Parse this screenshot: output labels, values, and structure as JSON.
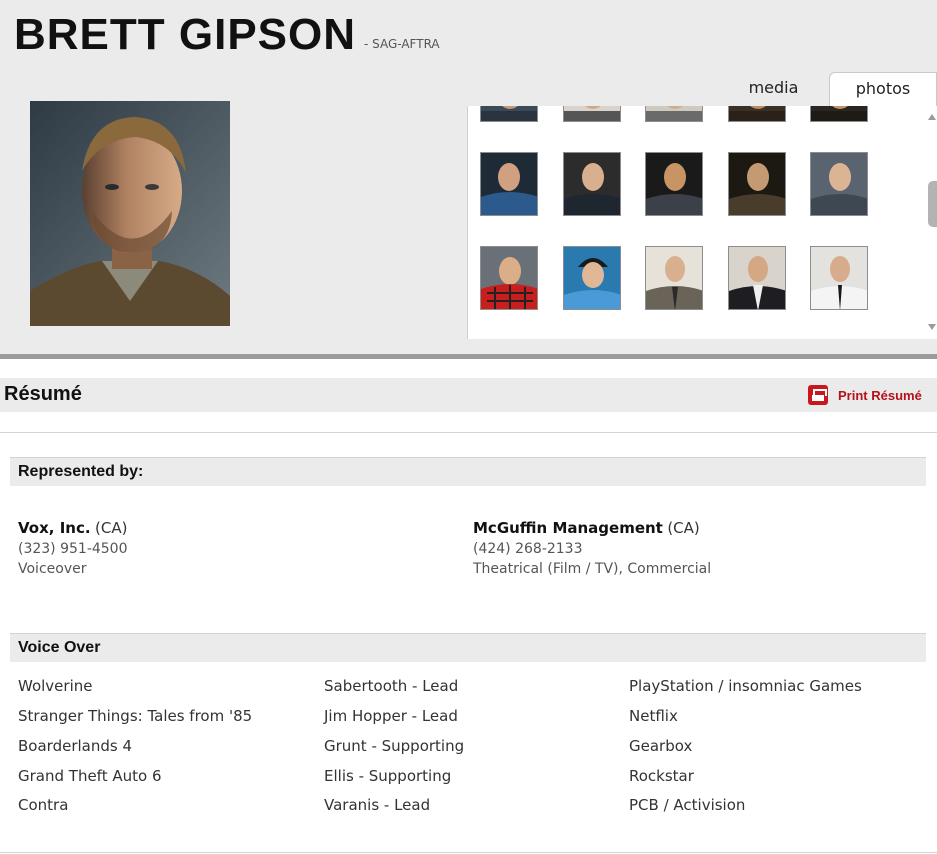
{
  "header": {
    "name": "BRETT GIPSON",
    "union": "- SAG-AFTRA"
  },
  "tabs": [
    {
      "label": "media"
    },
    {
      "label": "photos"
    }
  ],
  "resume": {
    "title": "Résumé",
    "print_label": "Print Résumé"
  },
  "represented": {
    "title": "Represented by:",
    "agencies": [
      {
        "name": "Vox, Inc.",
        "location": "(CA)",
        "phone": "(323) 951-4500",
        "type": "Voiceover"
      },
      {
        "name": "McGuffin Management",
        "location": "(CA)",
        "phone": "(424) 268-2133",
        "type": "Theatrical (Film / TV), Commercial"
      }
    ]
  },
  "voice_over": {
    "title": "Voice Over",
    "credits": [
      {
        "project": "Wolverine",
        "role": "Sabertooth - Lead",
        "company": "PlayStation / insomniac Games"
      },
      {
        "project": "Stranger Things: Tales from '85",
        "role": "Jim Hopper - Lead",
        "company": "Netflix"
      },
      {
        "project": "Boarderlands 4",
        "role": "Grunt - Supporting",
        "company": "Gearbox"
      },
      {
        "project": "Grand Theft Auto 6",
        "role": "Ellis - Supporting",
        "company": "Rockstar"
      },
      {
        "project": "Contra",
        "role": "Varanis - Lead",
        "company": "PCB / Activision"
      }
    ]
  },
  "colors": {
    "accent_red": "#b5121b",
    "band_grey": "#ebebeb"
  }
}
